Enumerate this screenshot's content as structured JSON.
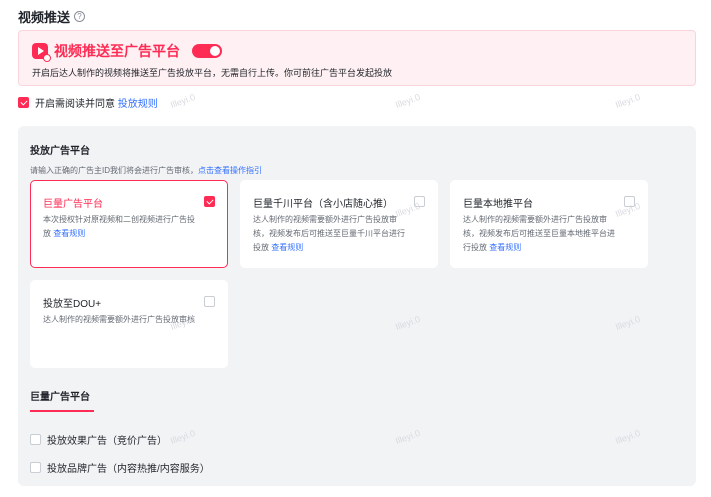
{
  "section": {
    "title": "视频推送",
    "help_icon": "?"
  },
  "banner": {
    "title": "视频推送至广告平台",
    "toggle_on": true,
    "description": "开启后达人制作的视频将推送至广告投放平台，无需自行上传。你可前往广告平台发起投放"
  },
  "agree": {
    "checked": true,
    "text": "开启需阅读并同意",
    "link": "投放规则"
  },
  "platform_panel": {
    "title": "投放广告平台",
    "hint_text": "请输入正确的广告主ID我们将会进行广告审核，",
    "hint_link": "点击查看操作指引",
    "cards": [
      {
        "title": "巨量广告平台",
        "selected": true,
        "desc_lines": [
          "本次授权针对原视频和二创视频进行广告投",
          "放"
        ],
        "link": "查看规则"
      },
      {
        "title": "巨量千川平台（含小店随心推）",
        "selected": false,
        "desc_lines": [
          "达人制作的视频需要额外进行广告投放审",
          "核，视频发布后可推送至巨量千川平台进行",
          "投放"
        ],
        "link": "查看规则"
      },
      {
        "title": "巨量本地推平台",
        "selected": false,
        "desc_lines": [
          "达人制作的视频需要额外进行广告投放审",
          "核，视频发布后可推送至巨量本地推平台进",
          "行投放"
        ],
        "link": "查看规则"
      },
      {
        "title": "投放至DOU+",
        "selected": false,
        "desc_lines": [
          "达人制作的视频需要额外进行广告投放审核"
        ],
        "link": ""
      }
    ]
  },
  "sub_section": {
    "title": "巨量广告平台",
    "options": [
      {
        "label": "投放效果广告（竞价广告）",
        "checked": false
      },
      {
        "label": "投放品牌广告（内容热推/内容服务）",
        "checked": false
      }
    ]
  },
  "watermark": "Illeyi.0",
  "colors": {
    "accent": "#fe2c55",
    "link": "#3370ff",
    "panel_bg": "#f2f3f5",
    "banner_bg": "#fff1f3"
  }
}
